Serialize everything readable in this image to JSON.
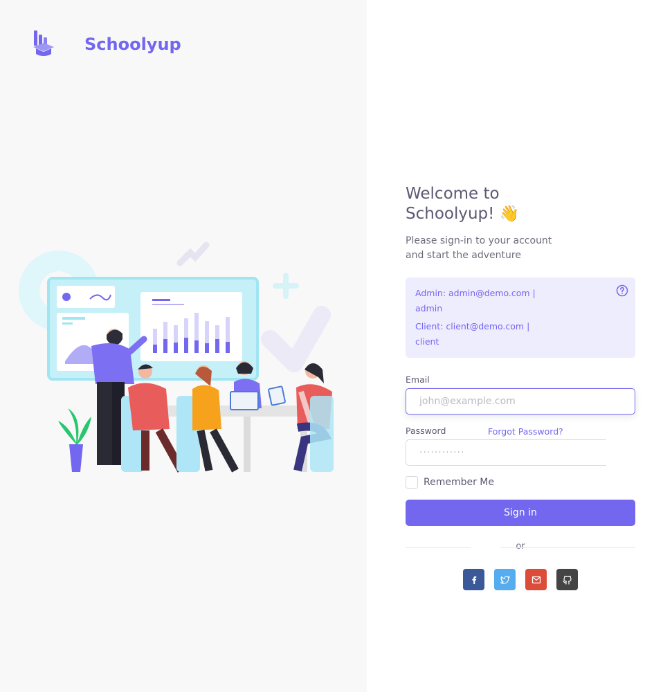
{
  "brand": {
    "name": "Schoolyup"
  },
  "login": {
    "title": "Welcome to Schoolyup! 👋",
    "subtitle": "Please sign-in to your account and start the adventure",
    "demo": {
      "admin": "Admin: admin@demo.com | admin",
      "client": "Client: client@demo.com | client"
    },
    "email": {
      "label": "Email",
      "placeholder": "john@example.com"
    },
    "password": {
      "label": "Password",
      "placeholder": "············",
      "forgot": "Forgot Password?"
    },
    "remember": "Remember Me",
    "submit": "Sign in",
    "divider": "or",
    "social": [
      {
        "name": "facebook-icon",
        "color": "#3b5998"
      },
      {
        "name": "twitter-icon",
        "color": "#55acee"
      },
      {
        "name": "mail-icon",
        "color": "#dd4b39"
      },
      {
        "name": "github-icon",
        "color": "#444444"
      }
    ]
  },
  "colors": {
    "primary": "#7367f0",
    "heading": "#5e5873",
    "body": "#6e6b7b",
    "panel": "#f8f8f8",
    "alert_bg": "#eeedfd"
  }
}
